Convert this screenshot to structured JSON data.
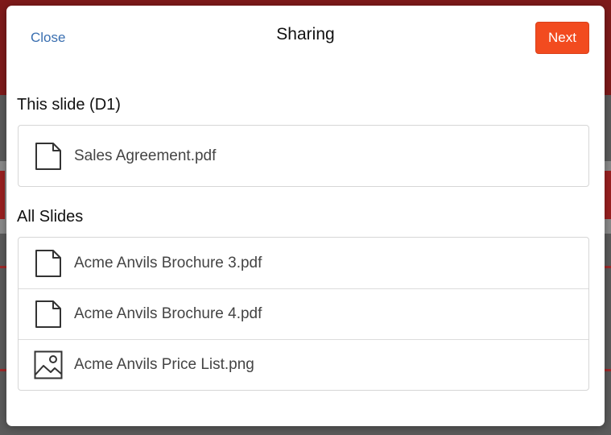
{
  "dialog": {
    "title": "Sharing",
    "close_label": "Close",
    "next_label": "Next"
  },
  "this_slide": {
    "heading": "This slide (D1)",
    "files": [
      {
        "name": "Sales Agreement.pdf",
        "icon": "document-icon"
      }
    ]
  },
  "all_slides": {
    "heading": "All Slides",
    "files": [
      {
        "name": "Acme Anvils Brochure 3.pdf",
        "icon": "document-icon"
      },
      {
        "name": "Acme Anvils Brochure 4.pdf",
        "icon": "document-icon"
      },
      {
        "name": "Acme Anvils Price List.png",
        "icon": "image-icon"
      }
    ]
  },
  "colors": {
    "accent": "#f24b1f",
    "link": "#3a6fb0"
  }
}
